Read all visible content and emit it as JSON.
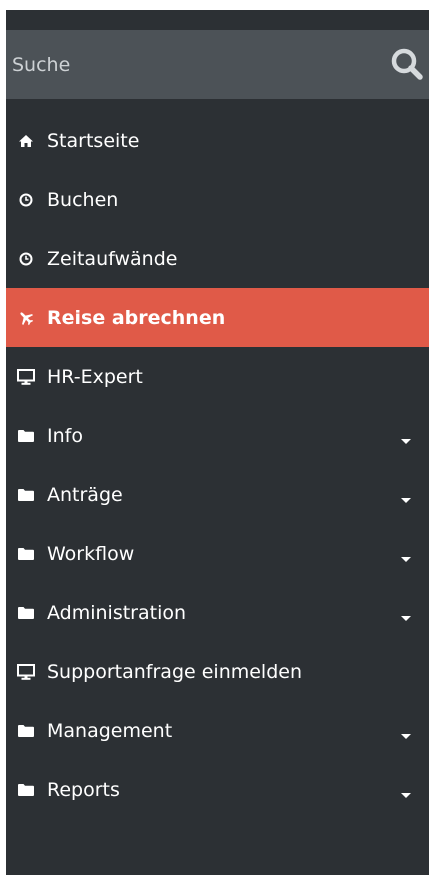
{
  "search": {
    "placeholder": "Suche",
    "value": ""
  },
  "menu": {
    "startseite": "Startseite",
    "buchen": "Buchen",
    "zeitaufwaende": "Zeitaufwände",
    "reise": "Reise abrechnen",
    "hrexpert": "HR-Expert",
    "info": "Info",
    "antraege": "Anträge",
    "workflow": "Workflow",
    "administration": "Administration",
    "support": "Supportanfrage einmelden",
    "management": "Management",
    "reports": "Reports"
  },
  "colors": {
    "sidebar_bg": "#2c3034",
    "search_bg": "#4c5257",
    "active_bg": "#e05a48",
    "text": "#ffffff"
  },
  "icons": {
    "startseite": "home-icon",
    "buchen": "clock-icon",
    "zeitaufwaende": "clock-icon",
    "reise": "plane-icon",
    "hrexpert": "monitor-icon",
    "folders": "folder-icon",
    "support": "monitor-icon",
    "search": "search-icon",
    "dropdown": "caret-down-icon"
  }
}
